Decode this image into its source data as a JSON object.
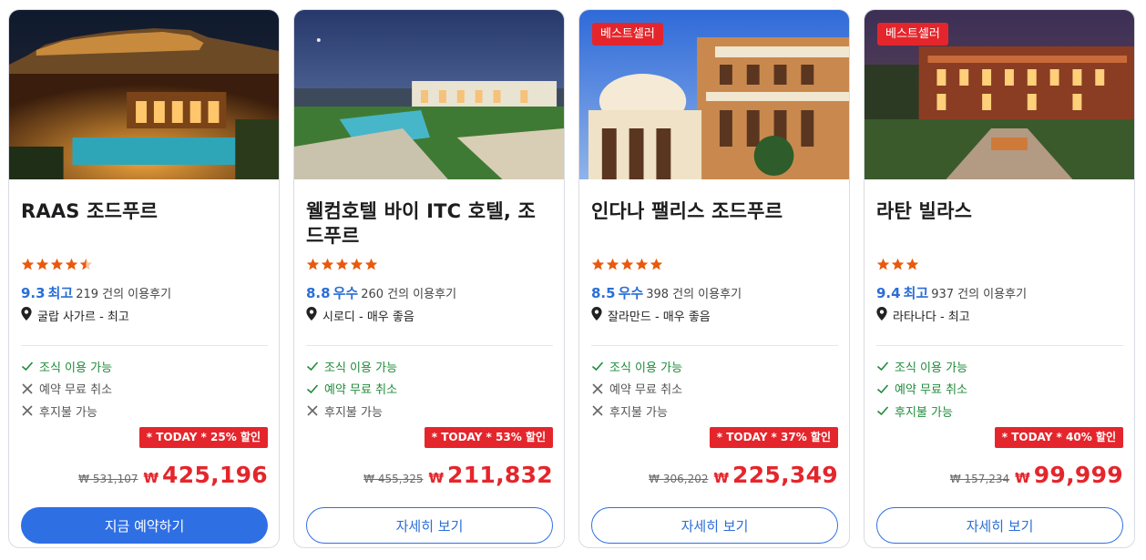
{
  "hotels": [
    {
      "badge": "",
      "name": "RAAS 조드푸르",
      "stars": 4.5,
      "score": "9.3",
      "score_label": "최고",
      "reviews": "219 건의 이용후기",
      "location": "굴랍 사가르 - 최고",
      "features": [
        {
          "label": "조식 이용 가능",
          "available": true
        },
        {
          "label": "예약 무료 취소",
          "available": false
        },
        {
          "label": "후지불 가능",
          "available": false
        }
      ],
      "promo": "* TODAY * 25% 할인",
      "original_price": "₩ 531,107",
      "currency": "₩",
      "price": "425,196",
      "button": "지금 예약하기",
      "button_primary": true
    },
    {
      "badge": "",
      "name": "웰컴호텔 바이 ITC 호텔, 조드푸르",
      "stars": 5,
      "score": "8.8",
      "score_label": "우수",
      "reviews": "260 건의 이용후기",
      "location": "시로디 - 매우 좋음",
      "features": [
        {
          "label": "조식 이용 가능",
          "available": true
        },
        {
          "label": "예약 무료 취소",
          "available": true
        },
        {
          "label": "후지불 가능",
          "available": false
        }
      ],
      "promo": "* TODAY * 53% 할인",
      "original_price": "₩ 455,325",
      "currency": "₩",
      "price": "211,832",
      "button": "자세히 보기",
      "button_primary": false
    },
    {
      "badge": "베스트셀러",
      "name": "인다나 팰리스 조드푸르",
      "stars": 5,
      "score": "8.5",
      "score_label": "우수",
      "reviews": "398 건의 이용후기",
      "location": "잘라만드 - 매우 좋음",
      "features": [
        {
          "label": "조식 이용 가능",
          "available": true
        },
        {
          "label": "예약 무료 취소",
          "available": false
        },
        {
          "label": "후지불 가능",
          "available": false
        }
      ],
      "promo": "* TODAY * 37% 할인",
      "original_price": "₩ 306,202",
      "currency": "₩",
      "price": "225,349",
      "button": "자세히 보기",
      "button_primary": false
    },
    {
      "badge": "베스트셀러",
      "name": "라탄 빌라스",
      "stars": 3,
      "score": "9.4",
      "score_label": "최고",
      "reviews": "937 건의 이용후기",
      "location": "라타나다 - 최고",
      "features": [
        {
          "label": "조식 이용 가능",
          "available": true
        },
        {
          "label": "예약 무료 취소",
          "available": true
        },
        {
          "label": "후지불 가능",
          "available": true
        }
      ],
      "promo": "* TODAY * 40% 할인",
      "original_price": "₩ 157,234",
      "currency": "₩",
      "price": "99,999",
      "button": "자세히 보기",
      "button_primary": false
    }
  ],
  "colors": {
    "accent_blue": "#2f6fe4",
    "sale_red": "#e4262c",
    "star_orange": "#e8590c",
    "check_green": "#1f8b3a"
  },
  "icons": {
    "location": "map-pin-icon",
    "available": "check-icon",
    "unavailable": "cross-icon",
    "rating": "star-icon"
  }
}
